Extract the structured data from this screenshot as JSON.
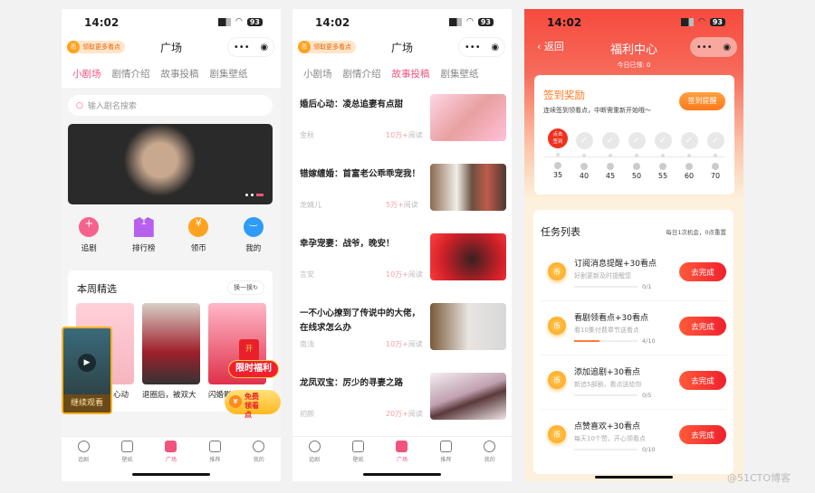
{
  "status": {
    "time": "14:02",
    "battery": "93"
  },
  "screen1": {
    "promo": "领取更多看点",
    "coin": "币",
    "title": "广场",
    "tabs": [
      "小剧场",
      "剧情介绍",
      "故事投稿",
      "剧集壁纸"
    ],
    "search_placeholder": "输入剧名搜索",
    "quick": [
      {
        "label": "追剧",
        "icon": "heart-plus-icon",
        "glyph": "+"
      },
      {
        "label": "排行榜",
        "icon": "crown-icon",
        "glyph": "1"
      },
      {
        "label": "领币",
        "icon": "coin-yen-icon",
        "glyph": "¥"
      },
      {
        "label": "我的",
        "icon": "user-icon",
        "glyph": "‿"
      }
    ],
    "weekly_title": "本周精选",
    "refresh": "换一换",
    "posters": [
      "心动",
      "退圈后，被双大",
      "闪婚影帝"
    ],
    "continue": "继续观看",
    "limited": "限时福利",
    "open": "开",
    "free": "免费领看点"
  },
  "screen2": {
    "title": "广场",
    "tabs": [
      "小剧场",
      "剧情介绍",
      "故事投稿",
      "剧集壁纸"
    ],
    "stories": [
      {
        "title": "婚后心动：凌总追妻有点甜",
        "author": "金秋",
        "reads": "10万+",
        "suffix": "阅读"
      },
      {
        "title": "错嫁缠婚：首富老公乖乖宠我！",
        "author": "龙婧儿",
        "reads": "5万+",
        "suffix": "阅读"
      },
      {
        "title": "幸孕宠妻：战爷，晚安！",
        "author": "言安",
        "reads": "10万+",
        "suffix": "阅读"
      },
      {
        "title": "一不小心撩到了传说中的大佬，在线求怎么办",
        "author": "南浅",
        "reads": "10万+",
        "suffix": "阅读"
      },
      {
        "title": "龙凤双宝：厉少的寻妻之路",
        "author": "初颜",
        "reads": "20万+",
        "suffix": "阅读"
      }
    ]
  },
  "nav": [
    "追剧",
    "壁纸",
    "广场",
    "推荐",
    "我的"
  ],
  "screen3": {
    "back": "返回",
    "title": "福利中心",
    "today": "今日已领: 0",
    "signin_title": "签到奖励",
    "signin_desc": "连续签到领看点，中断需重新开始哦～",
    "remind": "签到提醒",
    "sign_now": "点击签到",
    "days": [
      "35",
      "40",
      "45",
      "50",
      "55",
      "60",
      "70"
    ],
    "tasks_title": "任务列表",
    "tasks_note": "每日1次机会，0点重置",
    "tasks": [
      {
        "name": "订阅消息提醒+30看点",
        "desc": "好剧更新及时提醒您",
        "progress": "0/1",
        "pct": 0,
        "btn": "去完成"
      },
      {
        "name": "看剧领看点+30看点",
        "desc": "看10集付费章节送看点",
        "progress": "4/10",
        "pct": 40,
        "btn": "去完成"
      },
      {
        "name": "添加追剧+30看点",
        "desc": "新追5部剧，看点送给你",
        "progress": "0/5",
        "pct": 0,
        "btn": "去完成"
      },
      {
        "name": "点赞喜欢+30看点",
        "desc": "每天10个赞，开心领看点",
        "progress": "0/10",
        "pct": 0,
        "btn": "去完成"
      }
    ]
  },
  "watermark": "@51CTO博客",
  "colors": {
    "accent_pink": "#f2527e",
    "accent_red": "#f0202e",
    "orange": "#ff8a1f"
  }
}
